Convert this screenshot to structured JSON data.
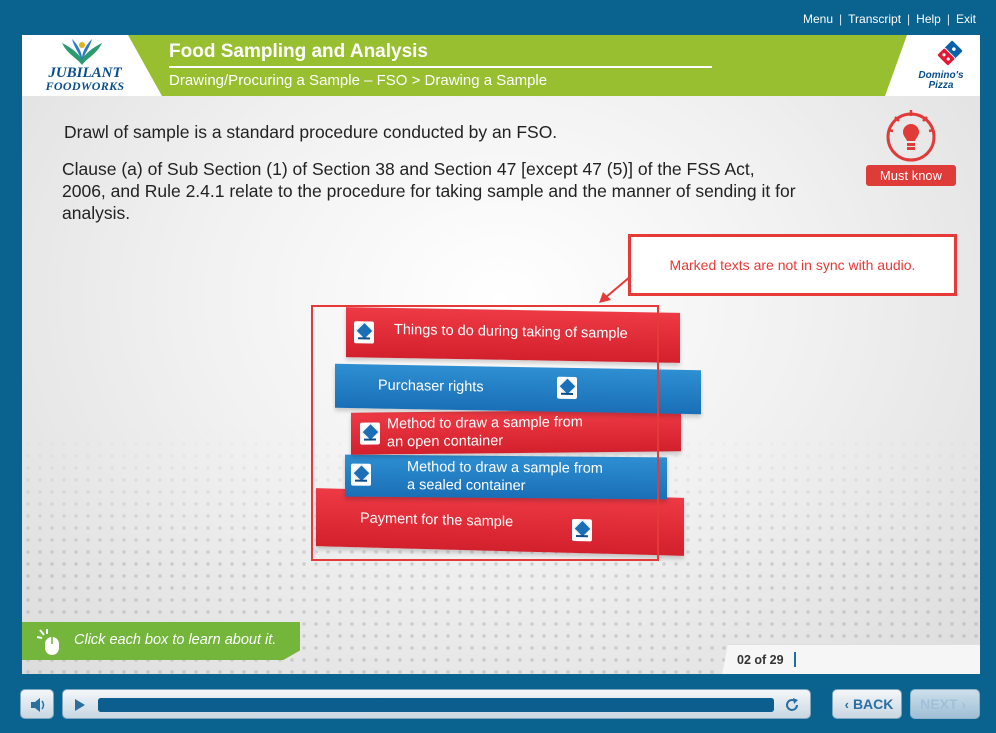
{
  "topmenu": {
    "menu": "Menu",
    "transcript": "Transcript",
    "help": "Help",
    "exit": "Exit",
    "sep": "|"
  },
  "header": {
    "title": "Food Sampling and Analysis",
    "subtitle": "Drawing/Procuring a Sample – FSO > Drawing a Sample",
    "logo_left_line1": "JUBILANT",
    "logo_left_line2": "FOODWORKS",
    "logo_right_line1": "Domino's",
    "logo_right_line2": "Pizza"
  },
  "content": {
    "para1": "Drawl of sample is a standard procedure conducted by an FSO.",
    "para2": "Clause (a) of Sub Section (1) of Section 38 and Section 47 [except 47 (5)] of the FSS Act, 2006, and Rule 2.4.1 relate to the procedure for taking sample and the manner of sending it for analysis."
  },
  "must_know": {
    "label": "Must know"
  },
  "callout": {
    "text": "Marked texts are not in sync with audio."
  },
  "boxes": [
    {
      "label": "Things to do during taking of sample",
      "color": "#de2a36"
    },
    {
      "label": "Purchaser rights",
      "color": "#1f7cc2"
    },
    {
      "label_line1": "Method to draw a sample from",
      "label_line2": "an open container",
      "color": "#de2a36"
    },
    {
      "label_line1": "Method to draw a sample from",
      "label_line2": "a sealed container",
      "color": "#1f7cc2"
    },
    {
      "label": "Payment for the sample",
      "color": "#de2a36"
    }
  ],
  "instruction": {
    "text": "Click each box to learn about it."
  },
  "page": {
    "indicator": "02 of 29"
  },
  "controls": {
    "back": "BACK",
    "next": "NEXT",
    "seek_progress": 1.0
  },
  "colors": {
    "frame": "#0a628e",
    "header_green": "#97bf2f",
    "accent_red": "#e53a38",
    "instruction_green": "#74b63b"
  }
}
